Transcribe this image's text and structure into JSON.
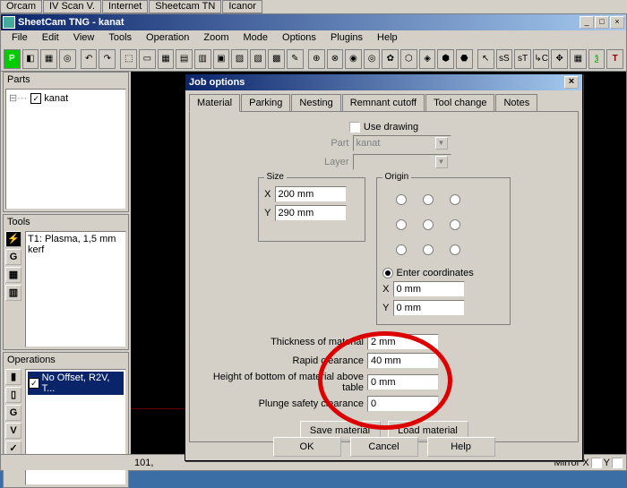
{
  "window": {
    "title": "SheetCam TNG - kanat"
  },
  "menu": {
    "file": "File",
    "edit": "Edit",
    "view": "View",
    "tools": "Tools",
    "operation": "Operation",
    "zoom": "Zoom",
    "mode": "Mode",
    "options": "Options",
    "plugins": "Plugins",
    "help": "Help"
  },
  "panels": {
    "parts": {
      "title": "Parts",
      "items": [
        "kanat"
      ]
    },
    "tools": {
      "title": "Tools",
      "items": [
        "T1: Plasma, 1,5 mm kerf"
      ]
    },
    "operations": {
      "title": "Operations",
      "items": [
        "No Offset, R2V, T..."
      ]
    }
  },
  "statusbar": {
    "coords": "101,",
    "mirror_x": "Mirror X",
    "y": "Y"
  },
  "dialog": {
    "title": "Job options",
    "tabs": [
      "Material",
      "Parking",
      "Nesting",
      "Remnant cutoff",
      "Tool change",
      "Notes"
    ],
    "use_drawing": "Use drawing",
    "part_label": "Part",
    "part_value": "kanat",
    "layer_label": "Layer",
    "layer_value": "",
    "size": {
      "legend": "Size",
      "x_label": "X",
      "x_value": "200 mm",
      "y_label": "Y",
      "y_value": "290 mm"
    },
    "origin": {
      "legend": "Origin",
      "enter_coords": "Enter coordinates",
      "x_label": "X",
      "x_value": "0 mm",
      "y_label": "Y",
      "y_value": "0 mm"
    },
    "fields": {
      "thickness_label": "Thickness of material",
      "thickness_value": "2 mm",
      "rapid_label": "Rapid clearance",
      "rapid_value": "40 mm",
      "height_label": "Height of bottom of material above table",
      "height_value": "0 mm",
      "plunge_label": "Plunge safety clearance",
      "plunge_value": "0"
    },
    "btn_save_mat": "Save material",
    "btn_load_mat": "Load material",
    "btn_ok": "OK",
    "btn_cancel": "Cancel",
    "btn_help": "Help"
  }
}
